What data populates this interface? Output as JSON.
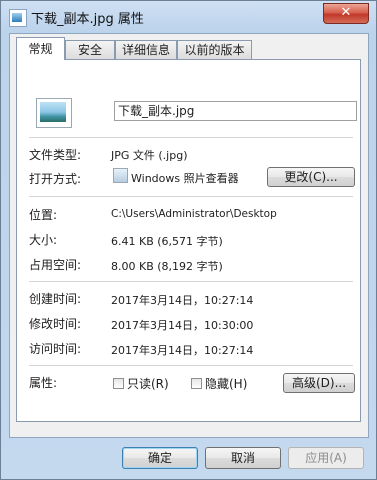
{
  "window": {
    "title": "下载_副本.jpg 属性",
    "close_glyph": "✕"
  },
  "tabs": [
    {
      "label": "常规",
      "active": true
    },
    {
      "label": "安全",
      "active": false
    },
    {
      "label": "详细信息",
      "active": false
    },
    {
      "label": "以前的版本",
      "active": false
    }
  ],
  "general": {
    "filename": "下载_副本.jpg",
    "file_type_label": "文件类型:",
    "file_type_value": "JPG 文件 (.jpg)",
    "opens_with_label": "打开方式:",
    "opens_with_value": "Windows 照片查看器",
    "change_button": "更改(C)...",
    "location_label": "位置:",
    "location_value": "C:\\Users\\Administrator\\Desktop",
    "size_label": "大小:",
    "size_value": "6.41 KB (6,571 字节)",
    "size_on_disk_label": "占用空间:",
    "size_on_disk_value": "8.00 KB (8,192 字节)",
    "created_label": "创建时间:",
    "created_value": "2017年3月14日，10:27:14",
    "modified_label": "修改时间:",
    "modified_value": "2017年3月14日，10:30:00",
    "accessed_label": "访问时间:",
    "accessed_value": "2017年3月14日，10:27:14",
    "attributes_label": "属性:",
    "readonly_label": "只读(R)",
    "readonly_checked": false,
    "hidden_label": "隐藏(H)",
    "hidden_checked": false,
    "advanced_button": "高级(D)..."
  },
  "footer": {
    "ok_button": "确定",
    "cancel_button": "取消",
    "apply_button": "应用(A)"
  }
}
